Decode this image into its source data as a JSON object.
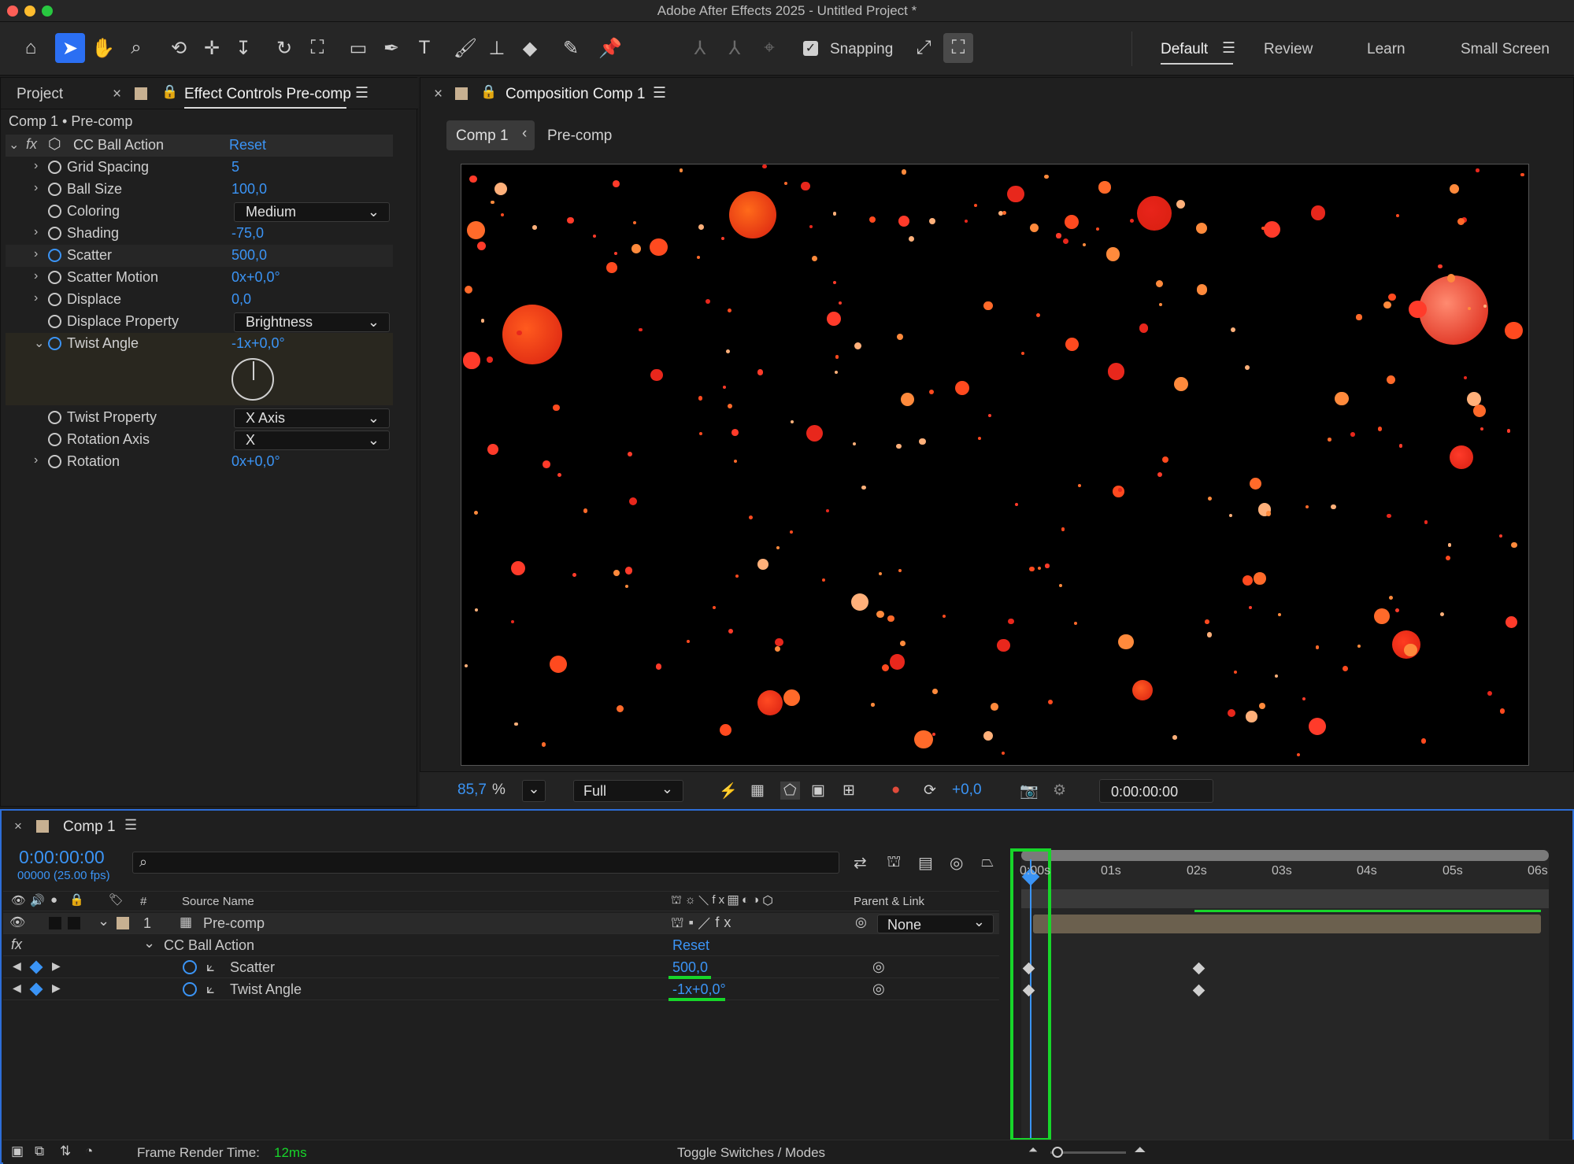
{
  "app": {
    "title": "Adobe After Effects 2025 - Untitled Project *"
  },
  "workspaces": [
    "Default",
    "Review",
    "Learn",
    "Small Screen"
  ],
  "toolbar": {
    "snapping_label": "Snapping"
  },
  "left_panel": {
    "tab_project": "Project",
    "tab_effect_controls": "Effect Controls Pre-comp",
    "breadcrumb": "Comp 1 • Pre-comp",
    "effect_name": "CC Ball Action",
    "reset": "Reset",
    "properties": [
      {
        "label": "Grid Spacing",
        "value": "5"
      },
      {
        "label": "Ball Size",
        "value": "100,0"
      },
      {
        "label": "Coloring",
        "value": "Medium"
      },
      {
        "label": "Shading",
        "value": "-75,0"
      },
      {
        "label": "Scatter",
        "value": "500,0"
      },
      {
        "label": "Scatter Motion",
        "value": "0x+0,0°"
      },
      {
        "label": "Displace",
        "value": "0,0"
      },
      {
        "label": "Displace Property",
        "value": "Brightness"
      },
      {
        "label": "Twist Angle",
        "value": "-1x+0,0°"
      },
      {
        "label": "Twist Property",
        "value": "X Axis"
      },
      {
        "label": "Rotation Axis",
        "value": "X"
      },
      {
        "label": "Rotation",
        "value": "0x+0,0°"
      }
    ]
  },
  "viewer": {
    "tab": "Composition Comp 1",
    "crumb_comp": "Comp 1",
    "crumb_precomp": "Pre-comp",
    "zoom": "85,7",
    "zoom_unit": "%",
    "resolution": "Full",
    "exposure": "+0,0",
    "timecode": "0:00:00:00"
  },
  "timeline": {
    "tab": "Comp 1",
    "timecode": "0:00:00:00",
    "fps": "00000 (25.00 fps)",
    "col_num": "#",
    "col_source": "Source Name",
    "col_parent": "Parent & Link",
    "layer_num": "1",
    "layer_name": "Pre-comp",
    "parent_value": "None",
    "effect_name": "CC Ball Action",
    "reset": "Reset",
    "props": [
      {
        "label": "Scatter",
        "value": "500,0"
      },
      {
        "label": "Twist Angle",
        "value": "-1x+0,0°"
      }
    ],
    "ruler": [
      "0:00s",
      "01s",
      "02s",
      "03s",
      "04s",
      "05s",
      "06s"
    ],
    "frame_render_label": "Frame Render Time:",
    "frame_render_value": "12ms",
    "toggle_label": "Toggle Switches / Modes"
  },
  "colors": {
    "accent": "#2b6ff3",
    "value_blue": "#3b94f5",
    "highlight_green": "#17d62a",
    "ball": "#ff4a1f"
  }
}
